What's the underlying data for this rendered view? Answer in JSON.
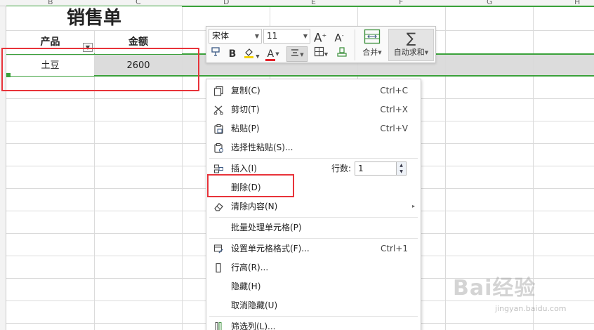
{
  "sheet": {
    "columns": [
      "B",
      "C",
      "D",
      "E",
      "F",
      "G",
      "H"
    ],
    "title": "销售单",
    "headers": {
      "product": "产品",
      "amount": "金额"
    },
    "row": {
      "product": "土豆",
      "amount": "2600"
    },
    "colors": {
      "selection_border": "#3aa13a",
      "highlight_box": "#e8333a",
      "row_highlight": "#dcdcdc"
    }
  },
  "mini_toolbar": {
    "font_name": "宋体",
    "font_size": "11",
    "grow_font_label": "A",
    "shrink_font_label": "A",
    "bold_label": "B",
    "font_color_label": "A",
    "merge_label": "合并",
    "autosum_label": "自动求和",
    "icons": [
      "format-painter-icon",
      "fill-color-icon",
      "font-color-icon",
      "align-center-icon",
      "borders-icon",
      "clear-format-icon",
      "merge-cells-icon",
      "sum-icon"
    ]
  },
  "context_menu": {
    "items": [
      {
        "label": "复制(C)",
        "shortcut": "Ctrl+C",
        "icon": "copy-icon"
      },
      {
        "label": "剪切(T)",
        "shortcut": "Ctrl+X",
        "icon": "scissors-icon"
      },
      {
        "label": "粘贴(P)",
        "shortcut": "Ctrl+V",
        "icon": "paste-icon"
      },
      {
        "label": "选择性粘贴(S)...",
        "shortcut": "",
        "icon": "paste-special-icon"
      },
      {
        "label": "插入(I)",
        "shortcut": "",
        "icon": "insert-rows-icon"
      },
      {
        "label": "删除(D)",
        "shortcut": "",
        "icon": ""
      },
      {
        "label": "清除内容(N)",
        "shortcut": "",
        "icon": "eraser-icon"
      },
      {
        "label": "批量处理单元格(P)",
        "shortcut": "",
        "icon": ""
      },
      {
        "label": "设置单元格格式(F)...",
        "shortcut": "Ctrl+1",
        "icon": "format-cells-icon"
      },
      {
        "label": "行高(R)...",
        "shortcut": "",
        "icon": "row-height-icon"
      },
      {
        "label": "隐藏(H)",
        "shortcut": "",
        "icon": ""
      },
      {
        "label": "取消隐藏(U)",
        "shortcut": "",
        "icon": ""
      },
      {
        "label": "筛选列(L)...",
        "shortcut": "",
        "icon": "filter-column-icon"
      }
    ],
    "insert_rows": {
      "label": "行数:",
      "value": "1"
    }
  },
  "watermark": {
    "main": "Bai经验",
    "sub": "jingyan.baidu.com"
  }
}
